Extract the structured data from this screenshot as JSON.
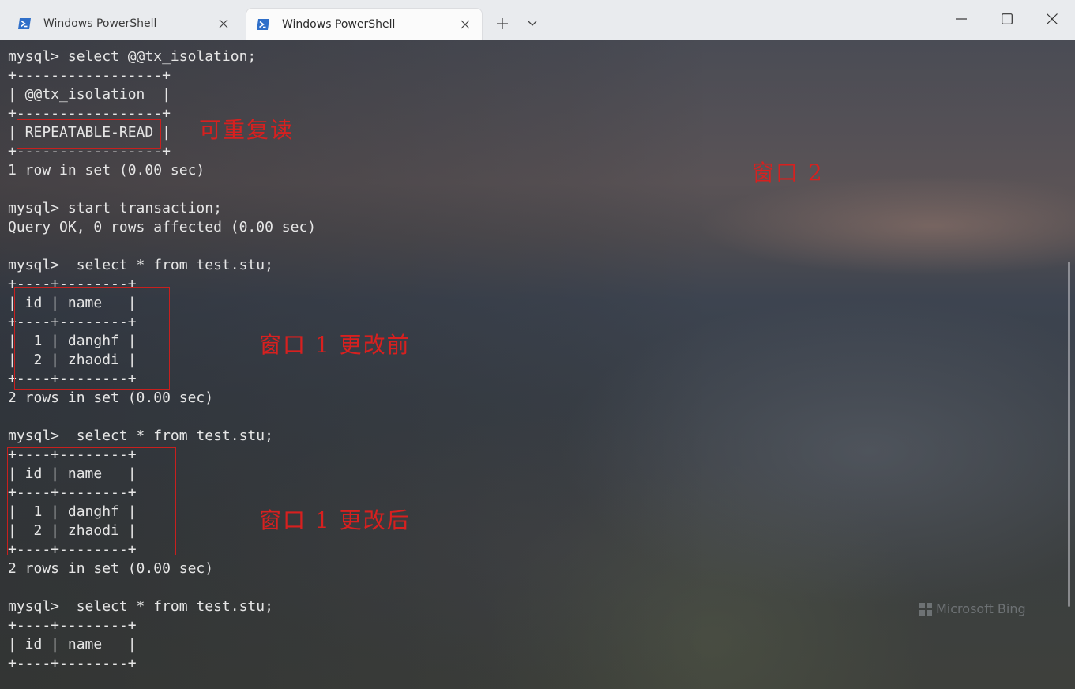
{
  "tabs": [
    {
      "title": "Windows PowerShell",
      "active": false
    },
    {
      "title": "Windows PowerShell",
      "active": true
    }
  ],
  "icons": {
    "tab": "powershell-icon",
    "close": "close-icon",
    "new_tab": "plus-icon",
    "dropdown": "chevron-down-icon",
    "minimize": "minimize-icon",
    "maximize": "maximize-icon",
    "window_close": "close-icon"
  },
  "terminal": {
    "lines": [
      "mysql> select @@tx_isolation;",
      "+-----------------+",
      "| @@tx_isolation  |",
      "+-----------------+",
      "| REPEATABLE-READ |",
      "+-----------------+",
      "1 row in set (0.00 sec)",
      "",
      "mysql> start transaction;",
      "Query OK, 0 rows affected (0.00 sec)",
      "",
      "mysql>  select * from test.stu;",
      "+----+--------+",
      "| id | name   |",
      "+----+--------+",
      "|  1 | danghf |",
      "|  2 | zhaodi |",
      "+----+--------+",
      "2 rows in set (0.00 sec)",
      "",
      "mysql>  select * from test.stu;",
      "+----+--------+",
      "| id | name   |",
      "+----+--------+",
      "|  1 | danghf |",
      "|  2 | zhaodi |",
      "+----+--------+",
      "2 rows in set (0.00 sec)",
      "",
      "mysql>  select * from test.stu;",
      "+----+--------+",
      "| id | name   |",
      "+----+--------+"
    ]
  },
  "annotations": {
    "repeatable_read": "可重复读",
    "window2": "窗口 2",
    "before_change": "窗口 1 更改前",
    "after_change": "窗口 1 更改后"
  },
  "watermark": "Microsoft Bing",
  "colors": {
    "annotation_red": "#d8201f",
    "terminal_text": "#e6e6e6",
    "titlebar": "#e9ebee"
  }
}
